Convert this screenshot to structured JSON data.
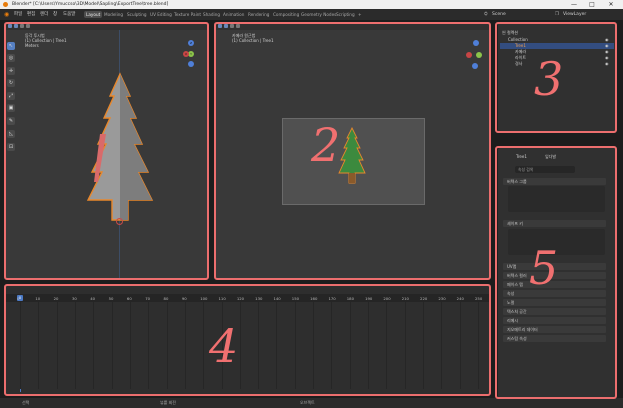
{
  "window": {
    "title": "Blender* [C:\\Users\\Ymuccso\\3D\\Model\\Sapling\\ExportTree\\tree.blend]",
    "controls": [
      "—",
      "□",
      "✕"
    ]
  },
  "menu": [
    "파일",
    "편집",
    "렌더",
    "창",
    "도움말"
  ],
  "workspaces": [
    "Layout",
    "Modeling",
    "Sculpting",
    "UV Editing",
    "Texture Paint",
    "Shading",
    "Animation",
    "Rendering",
    "Compositing",
    "Geometry Nodes",
    "Scripting",
    "+"
  ],
  "active_workspace": "Layout",
  "scene": {
    "label": "Scene",
    "view_layer": "ViewLayer"
  },
  "viewport1": {
    "line1": "등각 투시법",
    "line2": "(1) Collection | Tree1",
    "line3": "Meters",
    "tools": [
      "↖",
      "◎",
      "✛",
      "↻",
      "⤢",
      "▣",
      "✎",
      "◺",
      "⊡"
    ]
  },
  "viewport2": {
    "line1": "카메라 원근법",
    "line2": "(1) Collection | Tree1"
  },
  "outliner": {
    "scene_collection": "씬 컬렉션",
    "items": [
      "Collection",
      "Tree1",
      "카메라",
      "라이트",
      "경사"
    ]
  },
  "properties": {
    "object_name": "Tree1",
    "modifier": "잎다발",
    "search_placeholder": "속성 검색",
    "panels": [
      "버텍스 그룹",
      "셰이프 키",
      "UV맵",
      "버텍스 컬러",
      "페이스 맵",
      "속성",
      "노멀",
      "텍스처 공간",
      "리메시",
      "지오메트리 데이터",
      "커스텀 속성"
    ]
  },
  "timeline": {
    "current_frame": "0",
    "ticks": [
      "0",
      "10",
      "20",
      "30",
      "40",
      "50",
      "60",
      "70",
      "80",
      "90",
      "100",
      "110",
      "120",
      "130",
      "140",
      "150",
      "160",
      "170",
      "180",
      "190",
      "200",
      "210",
      "220",
      "230",
      "240",
      "250"
    ],
    "menu": [
      "재생",
      "키잉",
      "보기",
      "마커"
    ]
  },
  "status_bar": {
    "left": "선택",
    "middle": "뷰를 회전",
    "right": "오브젝트"
  },
  "annotations": [
    "1",
    "2",
    "3",
    "4",
    "5"
  ],
  "colors": {
    "accent": "#ec6e6e",
    "blender_orange": "#e87d0d",
    "active_blue": "#5680c2",
    "tree_green": "#3c8a3e"
  }
}
